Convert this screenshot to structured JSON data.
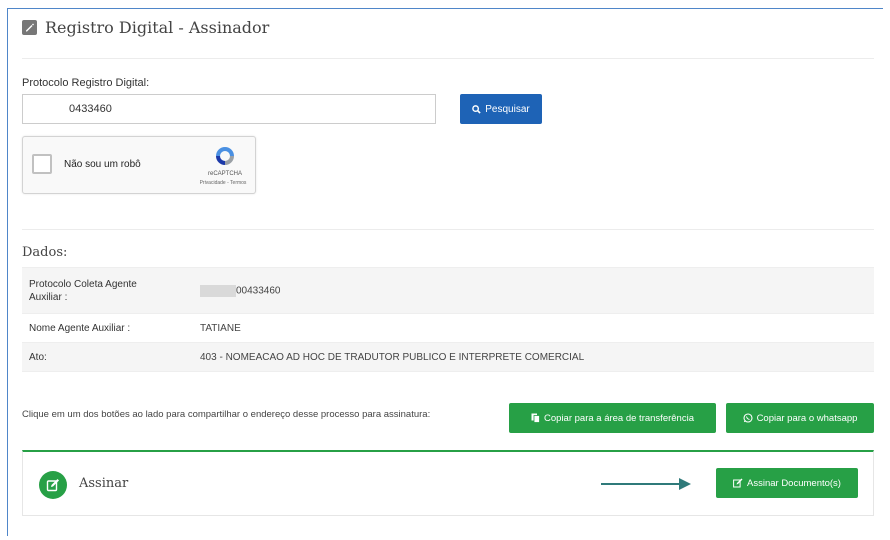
{
  "header": {
    "title": "Registro Digital - Assinador"
  },
  "search": {
    "label": "Protocolo Registro Digital:",
    "value": "0433460",
    "button_label": "Pesquisar"
  },
  "captcha": {
    "label": "Não sou um robô",
    "brand": "reCAPTCHA",
    "links": "Privacidade - Termos"
  },
  "dados": {
    "title": "Dados:",
    "rows": [
      {
        "label": "Protocolo Coleta Agente Auxiliar :",
        "value": "00433460"
      },
      {
        "label": "Nome Agente Auxiliar :",
        "value": "TATIANE"
      },
      {
        "label": "Ato:",
        "value": "403 - NOMEACAO AD HOC DE TRADUTOR PUBLICO E INTERPRETE COMERCIAL"
      }
    ]
  },
  "share": {
    "text": "Clique em um dos botões ao lado para compartilhar o endereço desse processo para assinatura:",
    "copy_clipboard_label": "Copiar para a área de transferência",
    "copy_whatsapp_label": "Copiar para o whatsapp"
  },
  "assinar": {
    "title": "Assinar",
    "button_label": "Assinar Documento(s)"
  },
  "colors": {
    "primary_blue": "#1e63b6",
    "success_green": "#27a046",
    "arrow_teal": "#2f7a7a"
  }
}
